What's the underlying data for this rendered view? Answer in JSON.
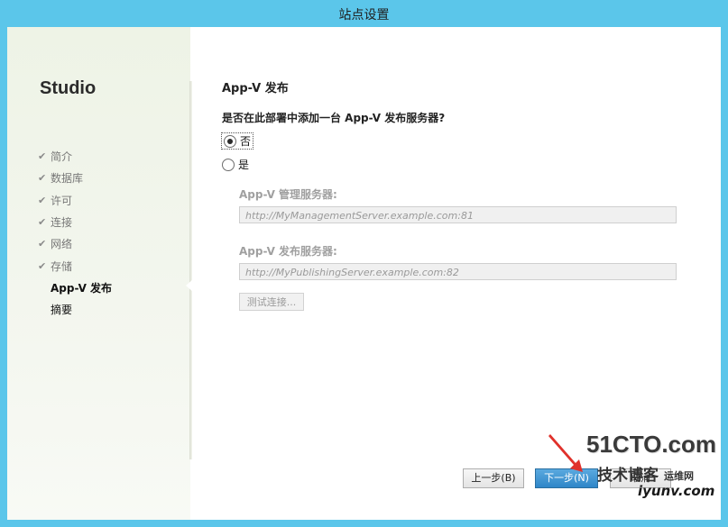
{
  "window": {
    "title": "站点设置"
  },
  "sidebar": {
    "brand": "Studio",
    "steps": [
      {
        "label": "简介",
        "state": "done"
      },
      {
        "label": "数据库",
        "state": "done"
      },
      {
        "label": "许可",
        "state": "done"
      },
      {
        "label": "连接",
        "state": "done"
      },
      {
        "label": "网络",
        "state": "done"
      },
      {
        "label": "存储",
        "state": "done"
      },
      {
        "label": "App-V 发布",
        "state": "active"
      },
      {
        "label": "摘要",
        "state": "pending"
      }
    ],
    "check_glyph": "✔"
  },
  "page": {
    "heading": "App-V 发布",
    "question": "是否在此部署中添加一台 App-V 发布服务器?",
    "options": [
      {
        "label": "否",
        "selected": true
      },
      {
        "label": "是",
        "selected": false
      }
    ],
    "management_label": "App-V 管理服务器:",
    "management_placeholder": "http://MyManagementServer.example.com:81",
    "publishing_label": "App-V 发布服务器:",
    "publishing_placeholder": "http://MyPublishingServer.example.com:82",
    "test_button": "测试连接..."
  },
  "footer": {
    "back": "上一步(B)",
    "next": "下一步(N)",
    "cancel": "取消"
  },
  "watermark": {
    "line1": "51CTO.com",
    "line2": "技术博客",
    "line3": "iyunv.com",
    "line4": "运维网"
  },
  "colors": {
    "titlebar": "#5bc6ea",
    "primary_button": "#2f86c8",
    "annotation_arrow": "#e0312b"
  }
}
